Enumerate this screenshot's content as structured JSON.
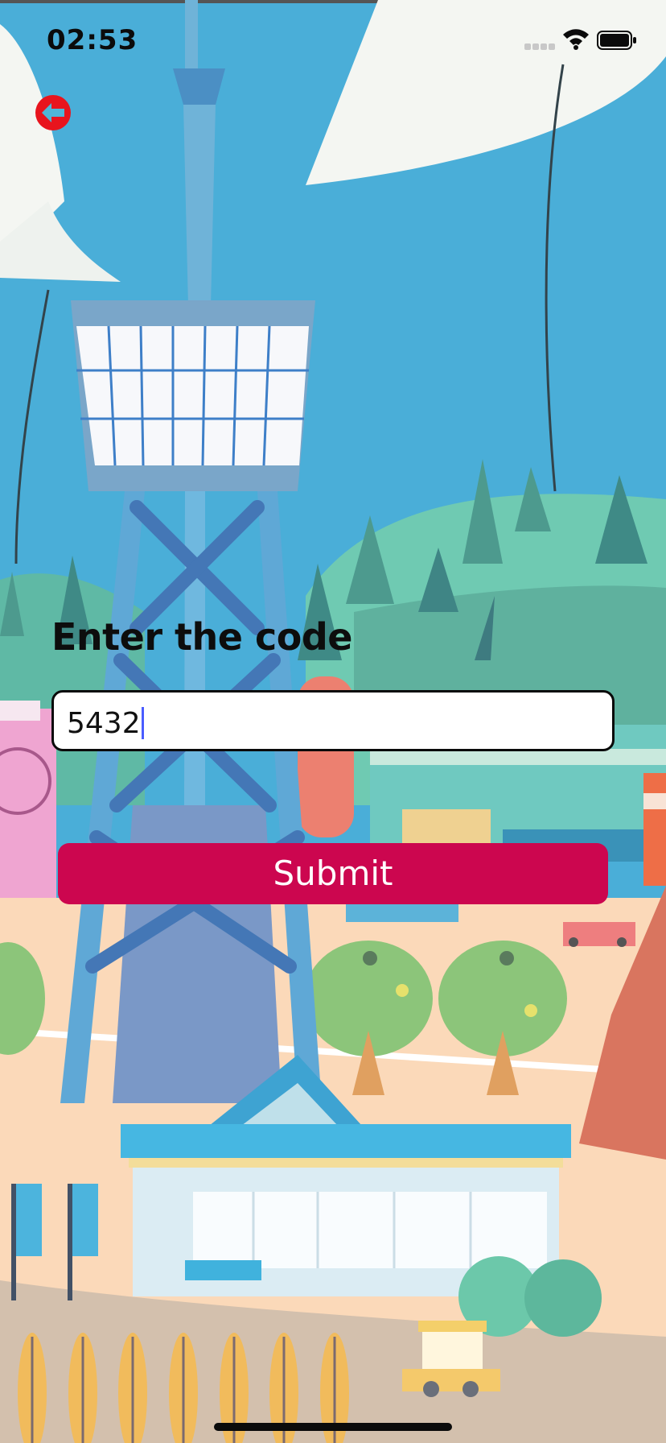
{
  "status_bar": {
    "time": "02:53"
  },
  "nav": {
    "back_icon": "back-arrow-icon"
  },
  "form": {
    "prompt": "Enter the code",
    "code_value": "5432",
    "submit_label": "Submit"
  },
  "colors": {
    "submit": "#cc064f",
    "back_button": "#e8141d",
    "caret": "#4a5cff"
  }
}
